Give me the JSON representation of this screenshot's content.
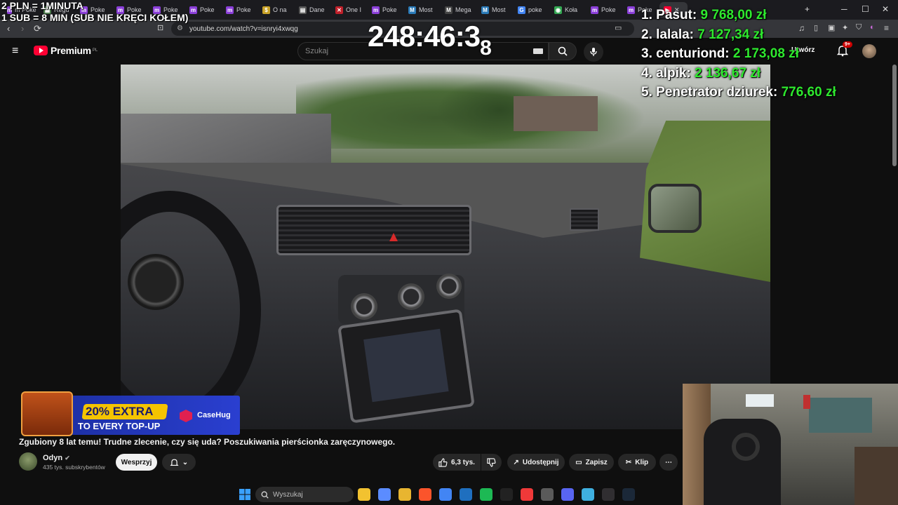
{
  "overlay": {
    "rules": [
      "2 PLN = 1MINUTA",
      "1 SUB = 8 MIN (SUB NIE KRĘCI KOŁEM)"
    ],
    "timer_main": "248:46:3",
    "timer_sub": "8",
    "leaderboard": [
      {
        "rank": "1.",
        "name": "Pasut:",
        "amount": "9 768,00 zł"
      },
      {
        "rank": "2.",
        "name": "lalala:",
        "amount": "7 127,34 zł"
      },
      {
        "rank": "3.",
        "name": "centuriond:",
        "amount": "2 173,08 zł"
      },
      {
        "rank": "4.",
        "name": "alpik:",
        "amount": "2 136,67 zł"
      },
      {
        "rank": "5.",
        "name": "Penetrator dziurek:",
        "amount": "776,60 zł"
      }
    ]
  },
  "browser": {
    "tabs": [
      {
        "label": "m Poke",
        "color": "#8b3fd9",
        "glyph": "m"
      },
      {
        "label": "Regu",
        "color": "#4a7a4a",
        "glyph": "▦"
      },
      {
        "label": "Poke",
        "color": "#8b3fd9",
        "glyph": "m"
      },
      {
        "label": "Poke",
        "color": "#8b3fd9",
        "glyph": "m"
      },
      {
        "label": "Poke",
        "color": "#8b3fd9",
        "glyph": "m"
      },
      {
        "label": "Poke",
        "color": "#8b3fd9",
        "glyph": "m"
      },
      {
        "label": "Poke",
        "color": "#8b3fd9",
        "glyph": "m"
      },
      {
        "label": "O na",
        "color": "#c9a227",
        "glyph": "$"
      },
      {
        "label": "Dane",
        "color": "#555",
        "glyph": "▤"
      },
      {
        "label": "One I",
        "color": "#c0202a",
        "glyph": "✕"
      },
      {
        "label": "Poke",
        "color": "#8b3fd9",
        "glyph": "m"
      },
      {
        "label": "Most",
        "color": "#2a7ab8",
        "glyph": "M"
      },
      {
        "label": "Mega",
        "color": "#444",
        "glyph": "M"
      },
      {
        "label": "Most",
        "color": "#2a7ab8",
        "glyph": "M"
      },
      {
        "label": "poke",
        "color": "#4285f4",
        "glyph": "G"
      },
      {
        "label": "Koła",
        "color": "#34a853",
        "glyph": "◉"
      },
      {
        "label": "Poke",
        "color": "#8b3fd9",
        "glyph": "m"
      },
      {
        "label": "Poke",
        "color": "#8b3fd9",
        "glyph": "m"
      }
    ],
    "url": "youtube.com/watch?v=isnryi4xwqg",
    "new_tab": "+",
    "win_min": "─",
    "win_max": "☐",
    "win_close": "✕"
  },
  "youtube": {
    "logo_text": "Premium",
    "logo_region": "PL",
    "search_placeholder": "Szukaj",
    "notif_count": "9+",
    "video_title": "Zgubiony 8 lat temu! Trudne zlecenie, czy się uda? Poszukiwania pierścionka zaręczynowego.",
    "channel_name": "Odyn",
    "channel_subs": "435 tys. subskrybentów",
    "support_label": "Wesprzyj",
    "like_count": "6,3 tys.",
    "share_label": "Udostępnij",
    "save_label": "Zapisz",
    "clip_label": "Klip",
    "partial_header_text": "Utwórz"
  },
  "promo": {
    "line1": "20% EXTRA",
    "line2": "TO EVERY TOP-UP",
    "brand": "CaseHug"
  },
  "taskbar": {
    "search_placeholder": "Wyszukaj",
    "apps": [
      {
        "name": "file-explorer-icon",
        "color": "#f2c230"
      },
      {
        "name": "copilot-icon",
        "color": "#5b8cff"
      },
      {
        "name": "folder-icon",
        "color": "#e8b530"
      },
      {
        "name": "brave-icon",
        "color": "#fb542b"
      },
      {
        "name": "chrome-icon",
        "color": "#4285f4"
      },
      {
        "name": "app-icon",
        "color": "#1f6fbf"
      },
      {
        "name": "spotify-icon",
        "color": "#1db954"
      },
      {
        "name": "muza-icon",
        "color": "#222"
      },
      {
        "name": "vivaldi-icon",
        "color": "#ef3939"
      },
      {
        "name": "calculator-icon",
        "color": "#5a5a5a"
      },
      {
        "name": "discord-icon",
        "color": "#5865f2"
      },
      {
        "name": "notepad-icon",
        "color": "#3fb0e0"
      },
      {
        "name": "obs-icon",
        "color": "#302e31"
      },
      {
        "name": "steam-icon",
        "color": "#1b2838"
      }
    ]
  }
}
